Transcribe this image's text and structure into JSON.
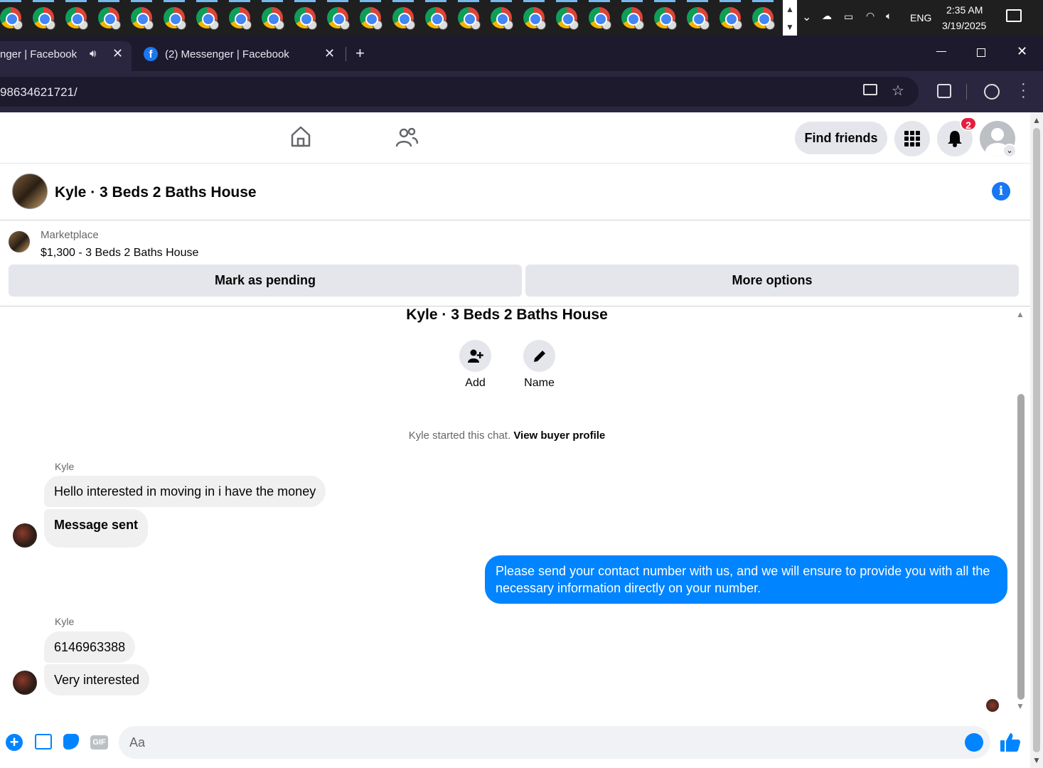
{
  "taskbar": {
    "clock_time": "2:35 AM",
    "clock_date": "3/19/2025",
    "language": "ENG",
    "icon_count": 24
  },
  "browser": {
    "tab1_title": "nger | Facebook",
    "tab2_title": "(2) Messenger | Facebook",
    "url": "98634621721/"
  },
  "fb_header": {
    "find_friends": "Find friends",
    "notifications_badge": "2"
  },
  "chat": {
    "title": "Kyle · 3 Beds 2 Baths House",
    "marketplace_label": "Marketplace",
    "listing": "$1,300 - 3 Beds 2 Baths House",
    "mark_pending": "Mark as pending",
    "more_options": "More options",
    "intro_title": "Kyle · 3 Beds 2 Baths House",
    "add_label": "Add",
    "name_label": "Name",
    "started_text": "Kyle started this chat.",
    "view_buyer": "View buyer profile",
    "composer_placeholder": "Aa"
  },
  "messages": [
    {
      "sender": "Kyle",
      "text": "Hello interested in moving in i have the money"
    },
    {
      "sender": "",
      "text": "Message sent"
    },
    {
      "sender": "me",
      "text": "Please send your contact number with us, and we will ensure to provide you with all the necessary information directly on your number."
    },
    {
      "sender": "Kyle",
      "text": "6146963388"
    },
    {
      "sender": "",
      "text": "Very interested"
    }
  ],
  "colors": {
    "fb_blue": "#0084ff",
    "badge_red": "#e41e3f",
    "info_blue": "#1877f2"
  }
}
